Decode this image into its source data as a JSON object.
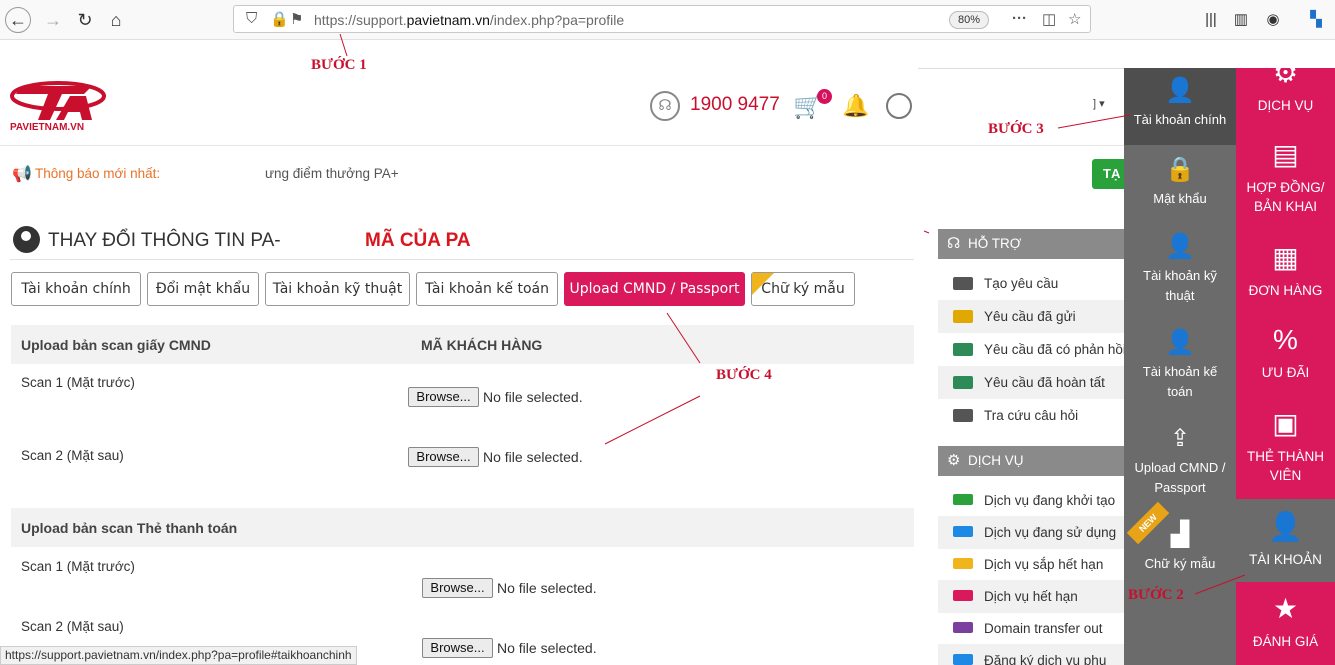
{
  "browser": {
    "url_prefix": "https://support.",
    "url_domain": "pavietnam.vn",
    "url_suffix": "/index.php?pa=profile",
    "zoom": "80%"
  },
  "header": {
    "logo_text": "PAVIETNAM.VN",
    "phone": "1900 9477",
    "cart_count": "0",
    "notice_label": "Thông báo mới nhất:",
    "notice_text": "ưng điểm thưởng PA+",
    "green_button": "TẠ"
  },
  "page": {
    "title": "THAY ĐỔI THÔNG TIN PA-",
    "code_label": "MÃ CỦA PA"
  },
  "tabs": [
    {
      "label": "Tài khoản chính"
    },
    {
      "label": "Đổi mật khẩu"
    },
    {
      "label": "Tài khoản kỹ thuật"
    },
    {
      "label": "Tài khoản kế toán"
    },
    {
      "label": "Upload CMND / Passport"
    },
    {
      "label": "Chữ ký mẫu"
    }
  ],
  "form": {
    "section1_title": "Upload bản scan giấy CMND",
    "section1_right": "MÃ KHÁCH HÀNG",
    "section2_title": "Upload bản scan Thẻ thanh toán",
    "scan1": "Scan 1 (Mặt trước)",
    "scan2": "Scan 2 (Mặt sau)",
    "browse": "Browse...",
    "no_file": "No file selected."
  },
  "support_panel": {
    "title": "HỖ TRỢ",
    "items": [
      "Tạo yêu cầu",
      "Yêu cầu đã gửi",
      "Yêu cầu đã có phản hồi",
      "Yêu cầu đã hoàn tất",
      "Tra cứu câu hỏi"
    ],
    "icon_colors": [
      "#555555",
      "#e0a800",
      "#2e8b57",
      "#2e8b57",
      "#555555"
    ]
  },
  "service_panel": {
    "title": "DỊCH VỤ",
    "items": [
      "Dịch vụ đang khởi tạo",
      "Dịch vụ đang sử dụng",
      "Dịch vụ sắp hết hạn",
      "Dịch vụ hết hạn",
      "Domain transfer out",
      "Đăng ký dịch vụ phụ"
    ],
    "icon_colors": [
      "#2aa13b",
      "#1e88e5",
      "#f0b51c",
      "#d9195c",
      "#7b3fa0",
      "#1e88e5"
    ]
  },
  "account_menu": {
    "items": [
      "Tài khoản chính",
      "Mật khẩu",
      "Tài khoản kỹ thuật",
      "Tài khoản kế toán",
      "Upload CMND / Passport",
      "Chữ ký mẫu"
    ],
    "new_badge": "NEW"
  },
  "main_menu": {
    "items": [
      "DỊCH VỤ",
      "HỢP ĐỒNG/ BẢN KHAI",
      "ĐƠN HÀNG",
      "ƯU ĐÃI",
      "THẺ THÀNH VIÊN",
      "TÀI KHOẢN",
      "ĐÁNH GIÁ"
    ]
  },
  "annotations": {
    "step1": "BƯỚC 1",
    "step2": "BƯỚC 2",
    "step3": "BƯỚC 3",
    "step4": "BƯỚC 4"
  },
  "status_url": "https://support.pavietnam.vn/index.php?pa=profile#taikhoanchinh",
  "colors": {
    "brand": "#d9195c",
    "logo_red": "#c8102e",
    "sidebar_gray": "#6b6b6b"
  }
}
